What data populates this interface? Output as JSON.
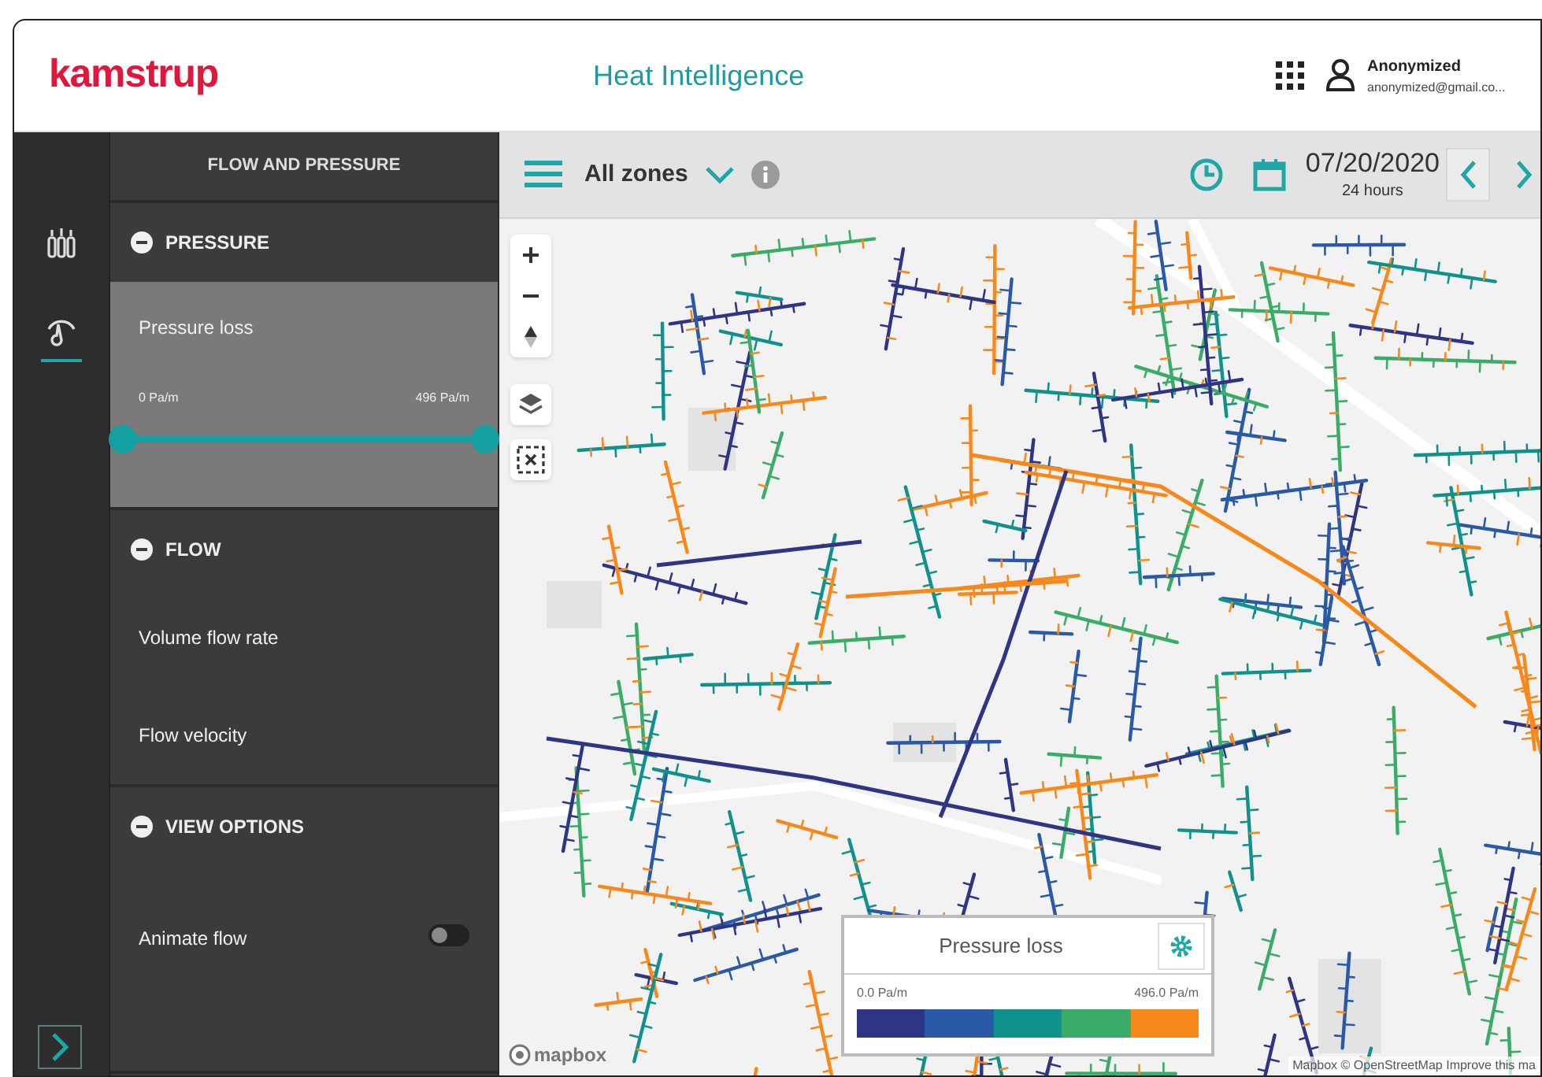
{
  "header": {
    "logo": "kamstrup",
    "app_title": "Heat Intelligence",
    "user": {
      "name": "Anonymized",
      "email": "anonymized@gmail.co..."
    }
  },
  "rail": {
    "items": [
      {
        "kind": "radiators",
        "selected": false
      },
      {
        "kind": "gauge",
        "selected": true
      }
    ]
  },
  "panel": {
    "title": "FLOW AND PRESSURE",
    "sections": [
      {
        "title": "PRESSURE",
        "expanded": true,
        "items": [
          {
            "kind": "slider",
            "label": "Pressure loss",
            "selected": true,
            "min_label": "0 Pa/m",
            "max_label": "496 Pa/m",
            "level": 1
          }
        ]
      },
      {
        "title": "FLOW",
        "expanded": true,
        "items": [
          {
            "kind": "option",
            "label": "Volume flow rate",
            "selected": false
          },
          {
            "kind": "option",
            "label": "Flow velocity",
            "selected": false
          }
        ]
      },
      {
        "title": "VIEW OPTIONS",
        "expanded": true,
        "items": [
          {
            "kind": "toggle",
            "label": "Animate flow",
            "on": false
          }
        ]
      }
    ]
  },
  "toolbar": {
    "zone": "All zones",
    "date": "07/20/2020",
    "period": "24 hours"
  },
  "legend": {
    "title": "Pressure loss",
    "min_label": "0.0 Pa/m",
    "max_label": "496.0 Pa/m",
    "bands": [
      {
        "color": "#2f3585"
      },
      {
        "color": "#2a5aa6"
      },
      {
        "color": "#10918c"
      },
      {
        "color": "#3aac68"
      },
      {
        "color": "#f7891c"
      }
    ]
  },
  "map": {
    "logo": "mapbox",
    "attribution": "Mapbox © OpenStreetMap Improve this ma"
  }
}
